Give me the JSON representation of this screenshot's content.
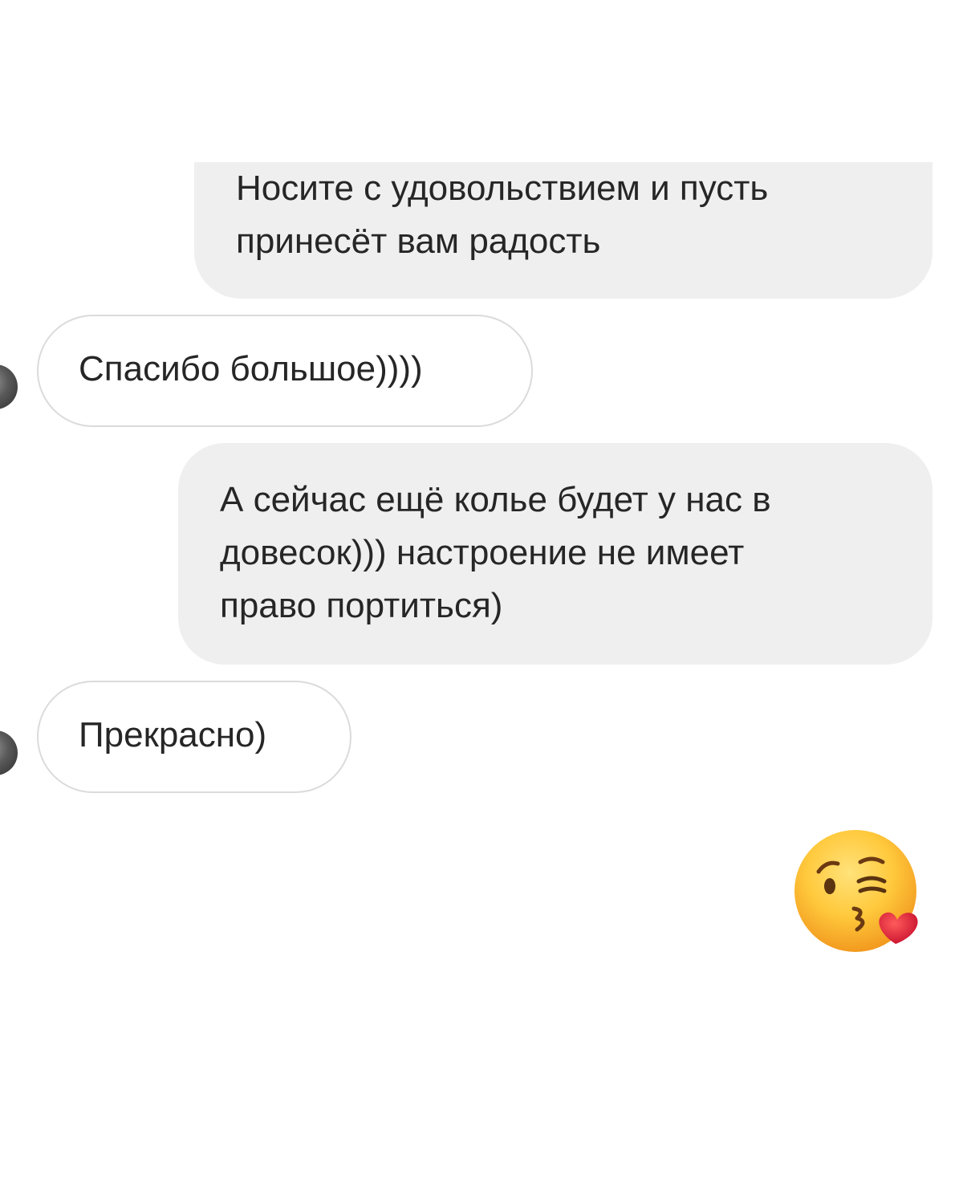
{
  "messages": [
    {
      "direction": "outgoing",
      "text": "Носите с удовольствием и пусть\nпринесёт вам радость"
    },
    {
      "direction": "incoming",
      "text": "Спасибо большое))))"
    },
    {
      "direction": "outgoing",
      "text": "А сейчас ещё колье будет у нас в\nдовесок))) настроение не имеет\nправо портиться)"
    },
    {
      "direction": "incoming",
      "text": "Прекрасно)"
    },
    {
      "direction": "outgoing",
      "type": "emoji",
      "icon": "face-blowing-a-kiss-emoji"
    }
  ],
  "colors": {
    "outgoing_bubble": "#efefef",
    "incoming_border": "#dbdbdb",
    "text": "#262626"
  }
}
